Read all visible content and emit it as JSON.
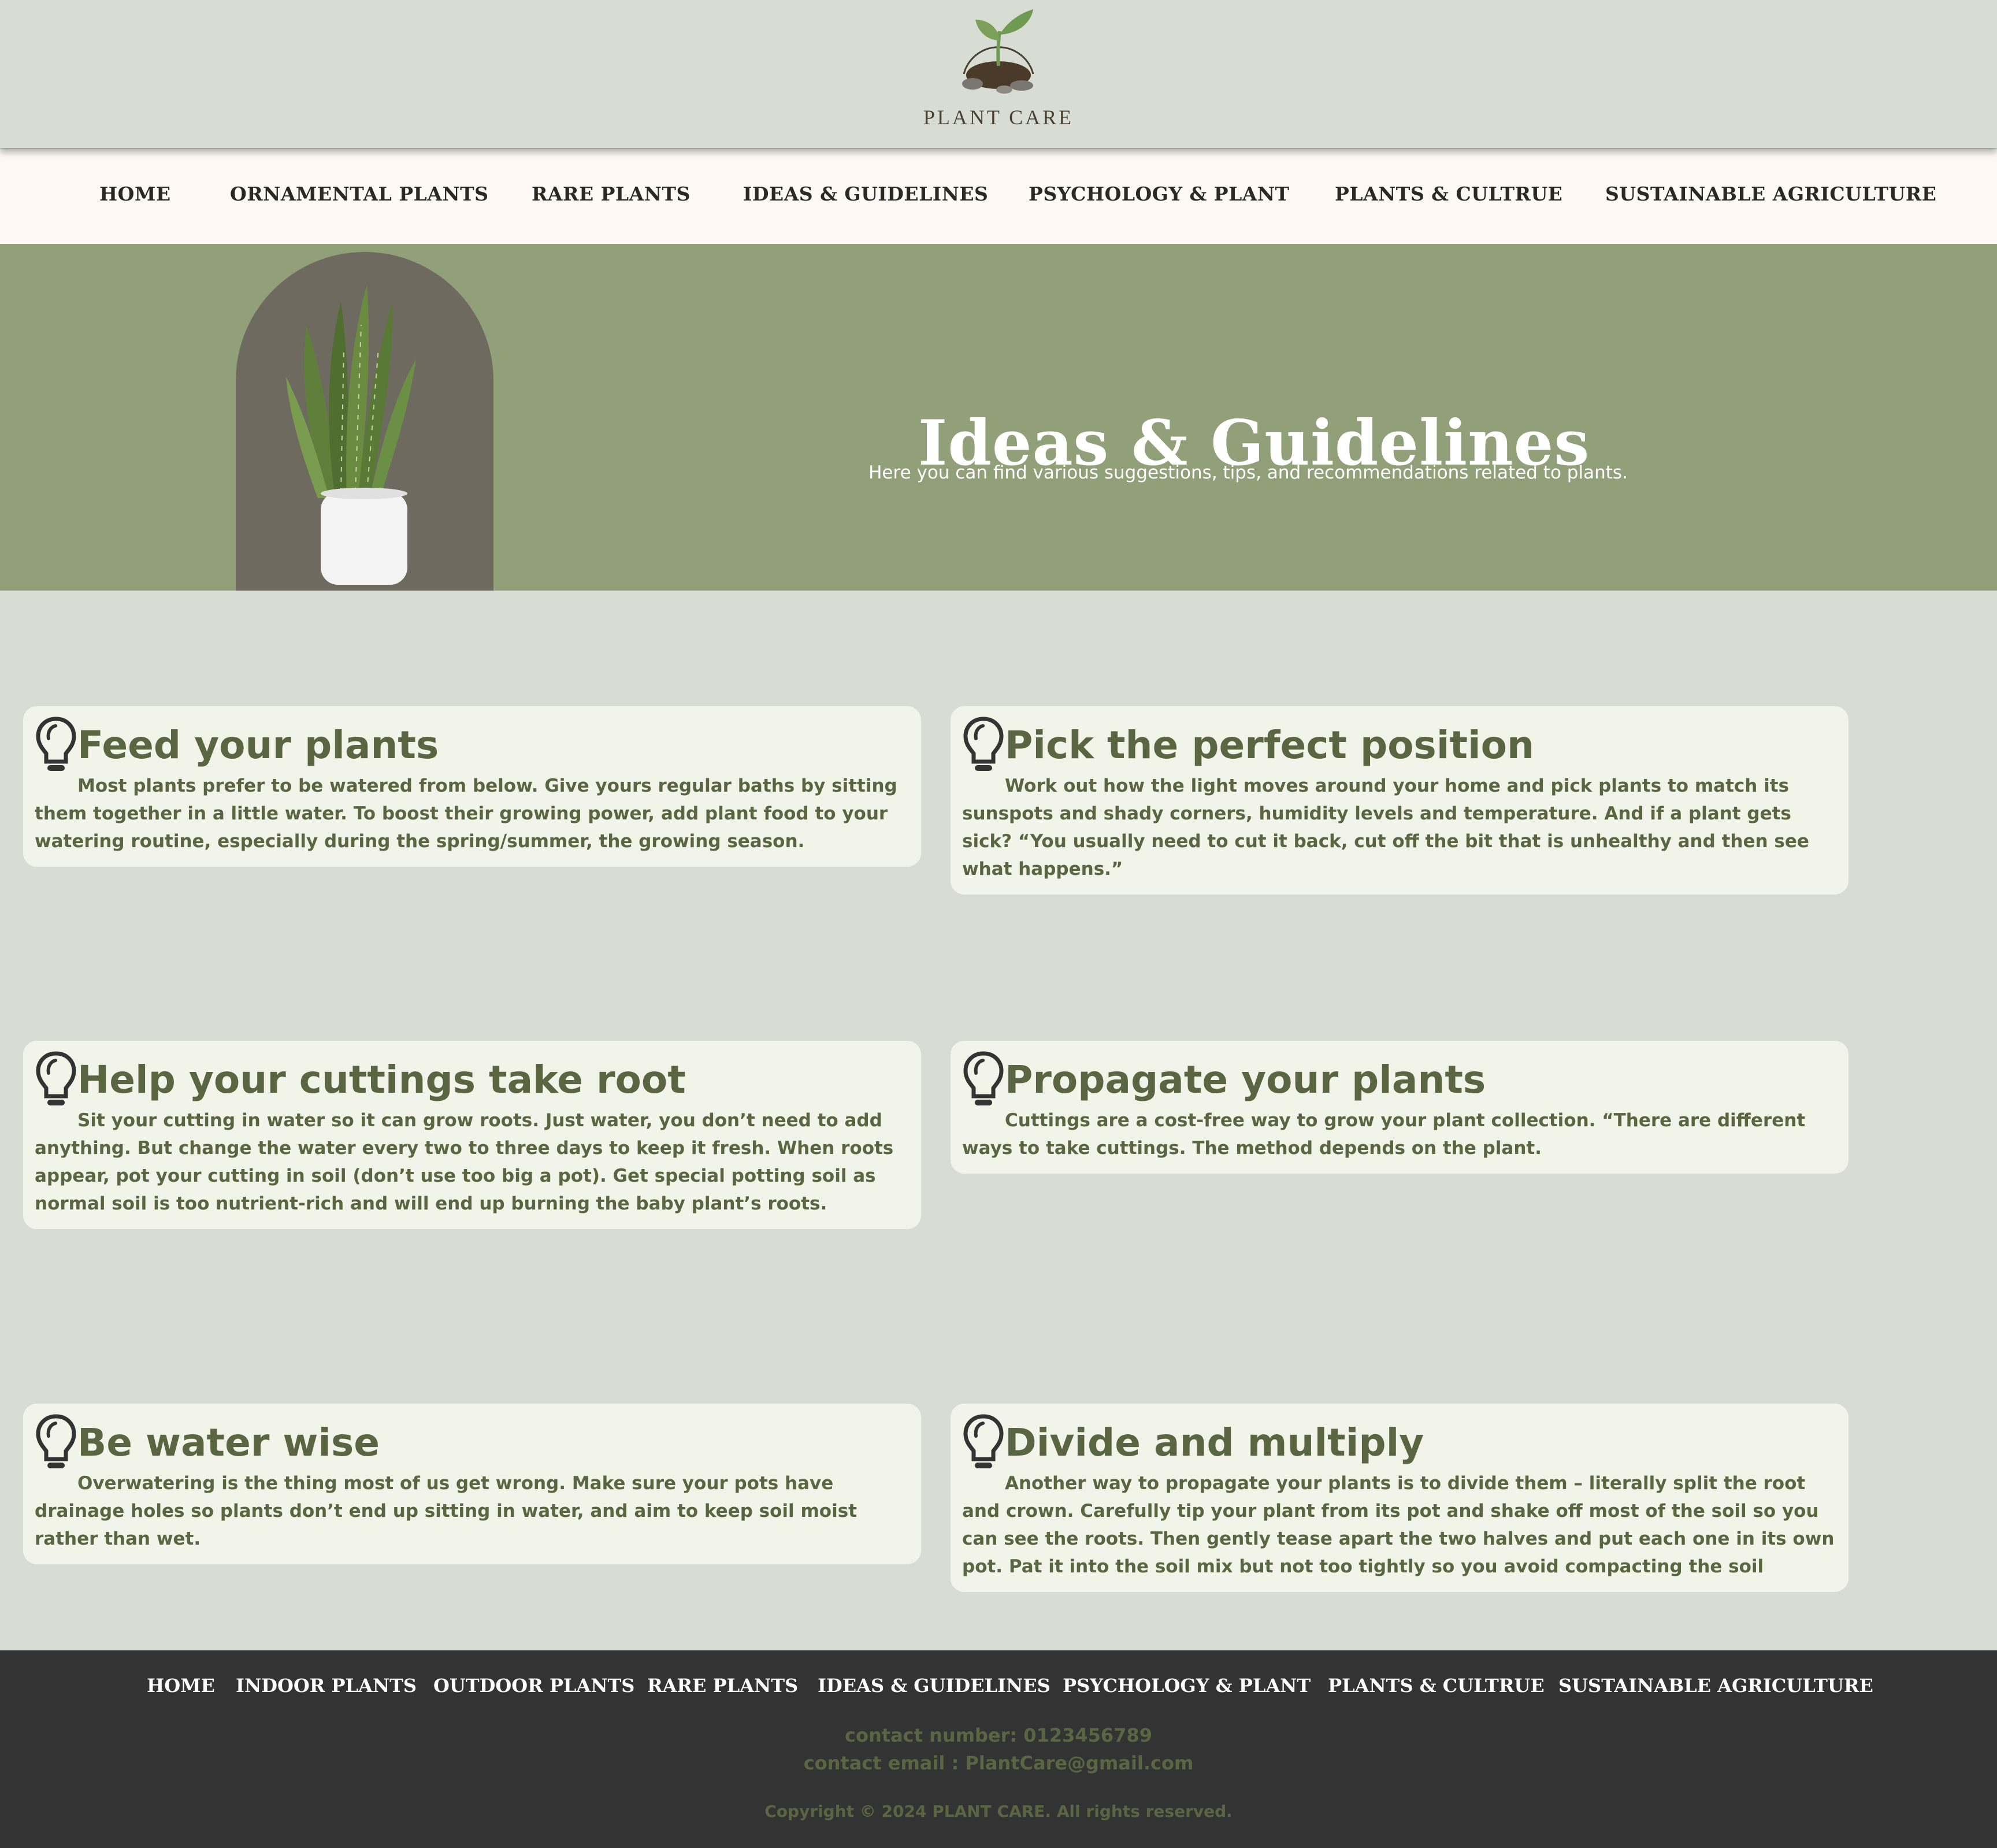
{
  "brand": {
    "name": "PLANT CARE",
    "logo_icon": "sprout-in-soil-logo"
  },
  "nav": {
    "items": [
      {
        "label": "HOME"
      },
      {
        "label": "ORNAMENTAL PLANTS"
      },
      {
        "label": "RARE PLANTS"
      },
      {
        "label": "IDEAS & GUIDELINES"
      },
      {
        "label": "PSYCHOLOGY & PLANT"
      },
      {
        "label": "PLANTS & CULTRUE"
      },
      {
        "label": "SUSTAINABLE AGRICULTURE"
      }
    ]
  },
  "hero": {
    "title": "Ideas & Guidelines",
    "subtitle": "Here you can find various suggestions, tips, and recommendations related to plants.",
    "image_icon": "snake-plant-image"
  },
  "cards": [
    {
      "icon": "lightbulb-icon",
      "title": "Feed your plants",
      "text": "Most plants prefer to be watered from below. Give yours regular baths by sitting them together in a little water. To boost their growing power, add plant food to your watering routine, especially during the spring/summer, the growing season."
    },
    {
      "icon": "lightbulb-icon",
      "title": "Pick the perfect position",
      "text": "Work out how the light moves around your home and pick plants to match its sunspots and shady corners, humidity levels and temperature. And if a plant gets sick? “You usually need to cut it back, cut off the bit that is unhealthy and then see what happens.”"
    },
    {
      "icon": "lightbulb-icon",
      "title": "Help your cuttings take root",
      "text": "Sit your cutting in water so it can grow roots. Just water, you don’t need to add anything. But change the water every two to three days to keep it fresh. When roots appear, pot your cutting in soil (don’t use too big a pot). Get special potting soil as normal soil is too nutrient-rich and will end up burning the baby plant’s roots."
    },
    {
      "icon": "lightbulb-icon",
      "title": "Propagate your plants",
      "text": "Cuttings are a cost-free way to grow your plant collection. “There are different ways to take cuttings. The method depends on the plant."
    },
    {
      "icon": "lightbulb-icon",
      "title": "Be water wise",
      "text": "Overwatering is the thing most of us get wrong. Make sure your pots have drainage holes so plants don’t end up sitting in water, and aim to keep soil moist rather than wet."
    },
    {
      "icon": "lightbulb-icon",
      "title": "Divide and multiply",
      "text": "Another way to propagate your plants is to divide them – literally split the root and crown. Carefully tip your plant from its pot and shake off most of the soil so you can see the roots. Then gently tease apart the two halves and put each one in its own pot. Pat it into the soil mix but not too tightly so you avoid compacting the soil"
    }
  ],
  "footer": {
    "nav": [
      {
        "label": "HOME"
      },
      {
        "label": "INDOOR PLANTS"
      },
      {
        "label": "OUTDOOR PLANTS"
      },
      {
        "label": "RARE PLANTS"
      },
      {
        "label": "IDEAS & GUIDELINES"
      },
      {
        "label": "PSYCHOLOGY & PLANT"
      },
      {
        "label": "PLANTS & CULTRUE"
      },
      {
        "label": "SUSTAINABLE AGRICULTURE"
      }
    ],
    "contact_number": "contact number: 0123456789",
    "contact_email": "contact email : PlantCare@gmail.com",
    "copyright": "Copyright © 2024 PLANT CARE. All rights reserved."
  },
  "colors": {
    "page_bg": "#d8ddd4",
    "nav_bg": "#fdf8f3",
    "hero_bg": "#91a078",
    "card_bg": "#f2f4e9",
    "card_text": "#5a6642",
    "footer_bg": "#333333"
  }
}
